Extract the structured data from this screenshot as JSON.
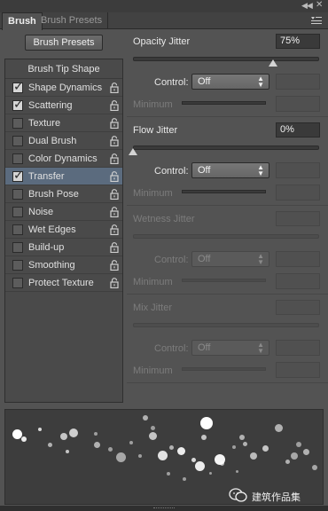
{
  "tabs": [
    {
      "label": "Brush",
      "active": true
    },
    {
      "label": "Brush Presets",
      "active": false
    }
  ],
  "brush_presets_button": "Brush Presets",
  "brush_tip_shape": "Brush Tip Shape",
  "options": [
    {
      "label": "Shape Dynamics",
      "checked": true,
      "selected": false
    },
    {
      "label": "Scattering",
      "checked": true,
      "selected": false
    },
    {
      "label": "Texture",
      "checked": false,
      "selected": false
    },
    {
      "label": "Dual Brush",
      "checked": false,
      "selected": false
    },
    {
      "label": "Color Dynamics",
      "checked": false,
      "selected": false
    },
    {
      "label": "Transfer",
      "checked": true,
      "selected": true
    },
    {
      "label": "Brush Pose",
      "checked": false,
      "selected": false
    },
    {
      "label": "Noise",
      "checked": false,
      "selected": false
    },
    {
      "label": "Wet Edges",
      "checked": false,
      "selected": false
    },
    {
      "label": "Build-up",
      "checked": false,
      "selected": false
    },
    {
      "label": "Smoothing",
      "checked": false,
      "selected": false
    },
    {
      "label": "Protect Texture",
      "checked": false,
      "selected": false
    }
  ],
  "sections": [
    {
      "title": "Opacity Jitter",
      "value": "75%",
      "slider_fraction": 0.75,
      "control_label": "Control:",
      "control_value": "Off",
      "minimum_label": "Minimum",
      "enabled": true
    },
    {
      "title": "Flow Jitter",
      "value": "0%",
      "slider_fraction": 0.0,
      "control_label": "Control:",
      "control_value": "Off",
      "minimum_label": "Minimum",
      "enabled": true
    },
    {
      "title": "Wetness Jitter",
      "value": "",
      "control_label": "Control:",
      "control_value": "Off",
      "minimum_label": "Minimum",
      "enabled": false
    },
    {
      "title": "Mix Jitter",
      "value": "",
      "control_label": "Control:",
      "control_value": "Off",
      "minimum_label": "Minimum",
      "enabled": false
    }
  ],
  "watermark": "建筑作品集"
}
